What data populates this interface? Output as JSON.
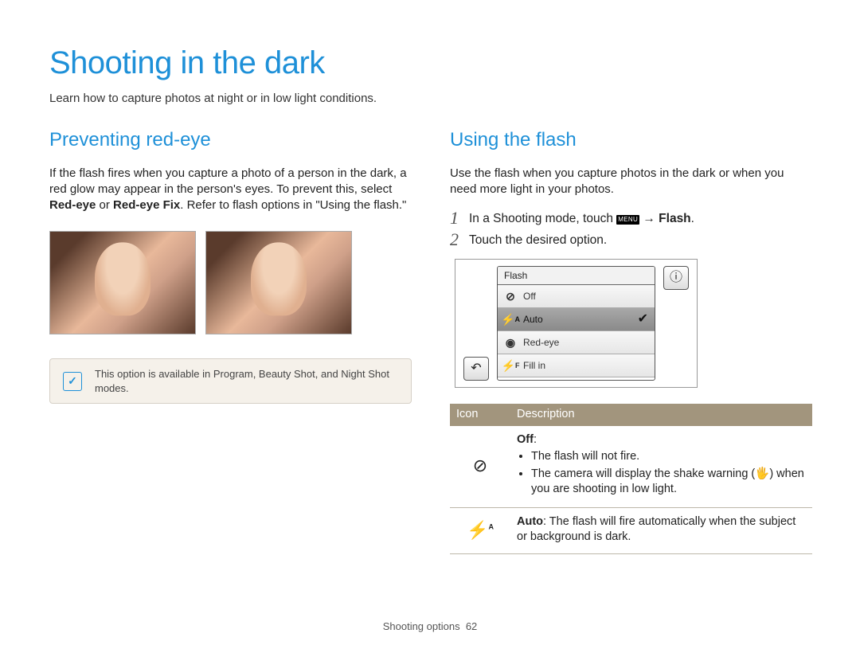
{
  "page": {
    "title": "Shooting in the dark",
    "intro": "Learn how to capture photos at night or in low light conditions.",
    "footer_section": "Shooting options",
    "footer_page": "62"
  },
  "left": {
    "heading": "Preventing red-eye",
    "body_pre": "If the flash fires when you capture a photo of a person in the dark, a red glow may appear in the person's eyes. To prevent this, select ",
    "bold1": "Red-eye",
    "or": " or ",
    "bold2": "Red-eye Fix",
    "body_post": ". Refer to flash options in \"Using the flash.\"",
    "note": "This option is available in Program, Beauty Shot, and Night Shot modes."
  },
  "right": {
    "heading": "Using the flash",
    "body": "Use the flash when you capture photos in the dark or when you need more light in your photos.",
    "step1_pre": "In a Shooting mode, touch ",
    "step1_menu": "MENU",
    "step1_arrow": " → ",
    "step1_bold": "Flash",
    "step1_post": ".",
    "step2": "Touch the desired option.",
    "menu": {
      "title": "Flash",
      "items": [
        "Off",
        "Auto",
        "Red-eye",
        "Fill in"
      ],
      "selected_index": 1
    },
    "table": {
      "head_icon": "Icon",
      "head_desc": "Description",
      "rows": [
        {
          "title": "Off",
          "bullets": [
            "The flash will not fire.",
            "The camera will display the shake warning (🖐) when you are shooting in low light."
          ]
        },
        {
          "title": "Auto",
          "rest": ": The flash will fire automatically when the subject or background is dark."
        }
      ]
    }
  }
}
